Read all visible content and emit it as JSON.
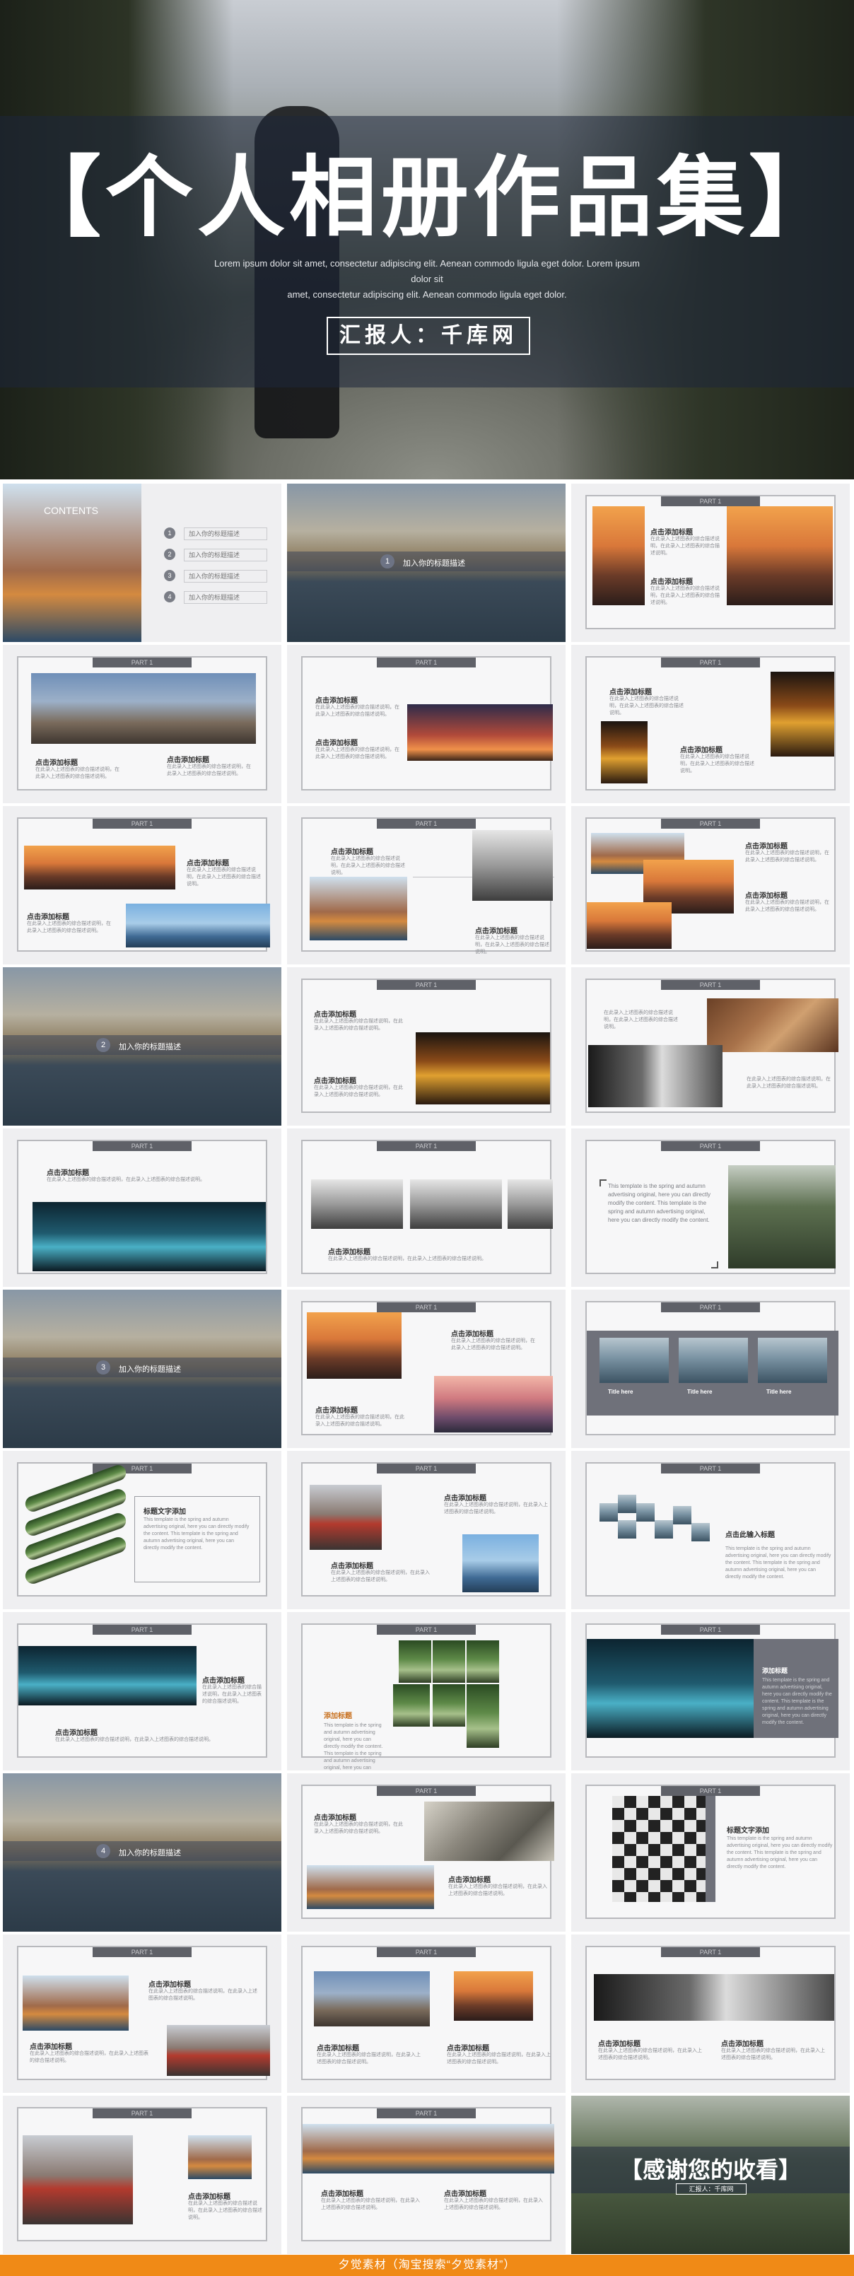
{
  "hero": {
    "title": "【个人相册作品集】",
    "subtitle_line1": "Lorem ipsum dolor sit amet, consectetur adipiscing elit. Aenean commodo ligula eget dolor. Lorem ipsum dolor sit",
    "subtitle_line2": "amet, consectetur adipiscing elit. Aenean commodo ligula eget dolor.",
    "reporter": "汇报人：千库网"
  },
  "contents": {
    "heading": "CONTENTS",
    "items": [
      {
        "num": "1",
        "label": "加入你的标题描述"
      },
      {
        "num": "2",
        "label": "加入你的标题描述"
      },
      {
        "num": "3",
        "label": "加入你的标题描述"
      },
      {
        "num": "4",
        "label": "加入你的标题描述"
      }
    ]
  },
  "part_label": "PART 1",
  "section_slides": [
    {
      "num": "1",
      "label": "加入你的标题描述"
    },
    {
      "num": "2",
      "label": "加入你的标题描述"
    },
    {
      "num": "3",
      "label": "加入你的标题描述"
    },
    {
      "num": "4",
      "label": "加入你的标题描述"
    }
  ],
  "click_title": "点击添加标题",
  "body_text": "在此录入上述图表的综合描述说明，在此录入上述图表的综合描述说明。",
  "template_text": "This template is the spring and autumn advertising original, here you can directly modify the content. This template is the spring and autumn advertising original, here you can directly modify the content.",
  "title_here": "Title here",
  "add_title": "添加标题",
  "text_title": "标题文字添加",
  "click_input_title": "点击此输入标题",
  "thanks": "【感谢您的收看】",
  "thanks_sub": "汇报人：千库网",
  "footer": "夕觉素材（淘宝搜索“夕觉素材”）"
}
